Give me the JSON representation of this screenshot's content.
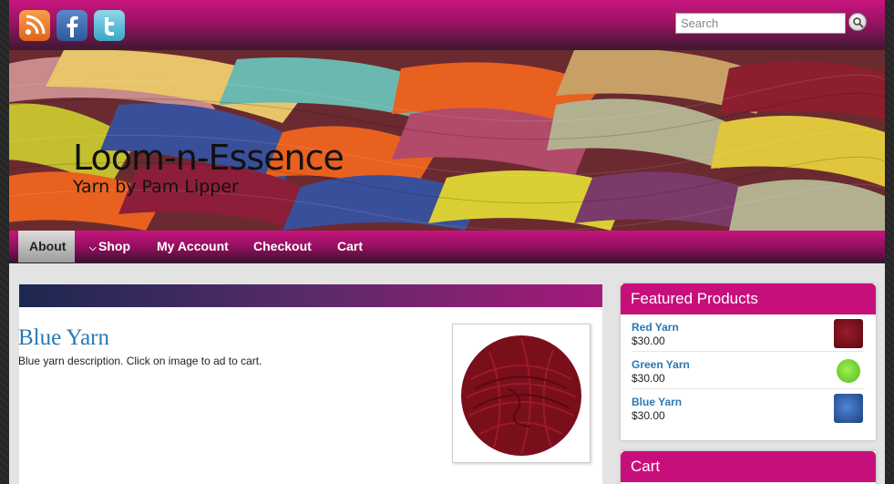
{
  "header": {
    "search_placeholder": "Search",
    "social": [
      "rss-icon",
      "facebook-icon",
      "twitter-icon"
    ]
  },
  "site": {
    "title": "Loom-n-Essence",
    "tagline": "Yarn by Pam Lipper"
  },
  "nav": {
    "items": [
      {
        "label": "About",
        "active": true
      },
      {
        "label": "Shop",
        "has_dropdown": true
      },
      {
        "label": "My Account"
      },
      {
        "label": "Checkout"
      },
      {
        "label": "Cart"
      }
    ]
  },
  "post": {
    "title": "Blue Yarn",
    "description": "Blue yarn description. Click on image to ad to cart."
  },
  "featured": {
    "heading": "Featured Products",
    "items": [
      {
        "name": "Red Yarn",
        "price": "$30.00",
        "color": "#7a0f1c"
      },
      {
        "name": "Green Yarn",
        "price": "$30.00",
        "color": "#7fd63a"
      },
      {
        "name": "Blue Yarn",
        "price": "$30.00",
        "color": "#2f5fa8"
      }
    ]
  },
  "cart": {
    "heading": "Cart"
  },
  "colors": {
    "accent": "#c70f7b",
    "link": "#2878b5"
  }
}
